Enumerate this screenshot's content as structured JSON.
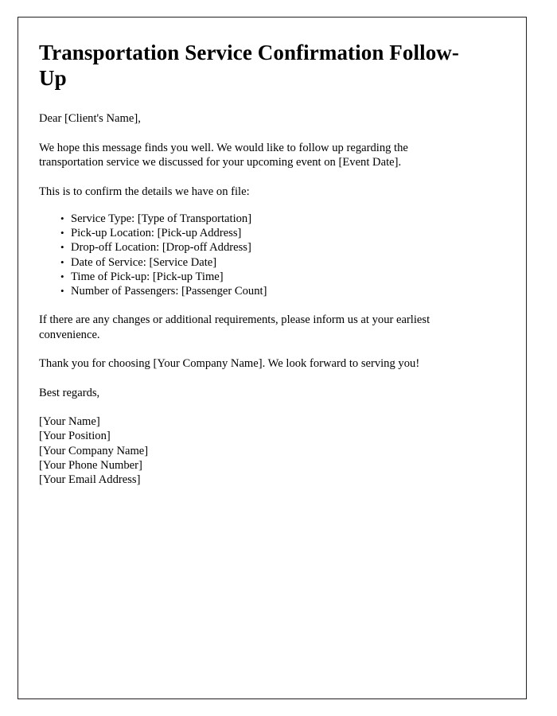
{
  "document": {
    "title": "Transportation Service Confirmation Follow-Up",
    "salutation": "Dear [Client's Name],",
    "intro_paragraph": "We hope this message finds you well. We would like to follow up regarding the transportation service we discussed for your upcoming event on [Event Date].",
    "confirm_lead_in": "This is to confirm the details we have on file:",
    "details": [
      "Service Type: [Type of Transportation]",
      "Pick-up Location: [Pick-up Address]",
      "Drop-off Location: [Drop-off Address]",
      "Date of Service: [Service Date]",
      "Time of Pick-up: [Pick-up Time]",
      "Number of Passengers: [Passenger Count]"
    ],
    "changes_paragraph": "If there are any changes or additional requirements, please inform us at your earliest convenience.",
    "thanks_paragraph": "Thank you for choosing [Your Company Name]. We look forward to serving you!",
    "closing": "Best regards,",
    "signature": [
      "[Your Name]",
      "[Your Position]",
      "[Your Company Name]",
      "[Your Phone Number]",
      "[Your Email Address]"
    ]
  },
  "style": {
    "page_background": "#ffffff",
    "text_color": "#000000",
    "border_color": "#231f20"
  }
}
